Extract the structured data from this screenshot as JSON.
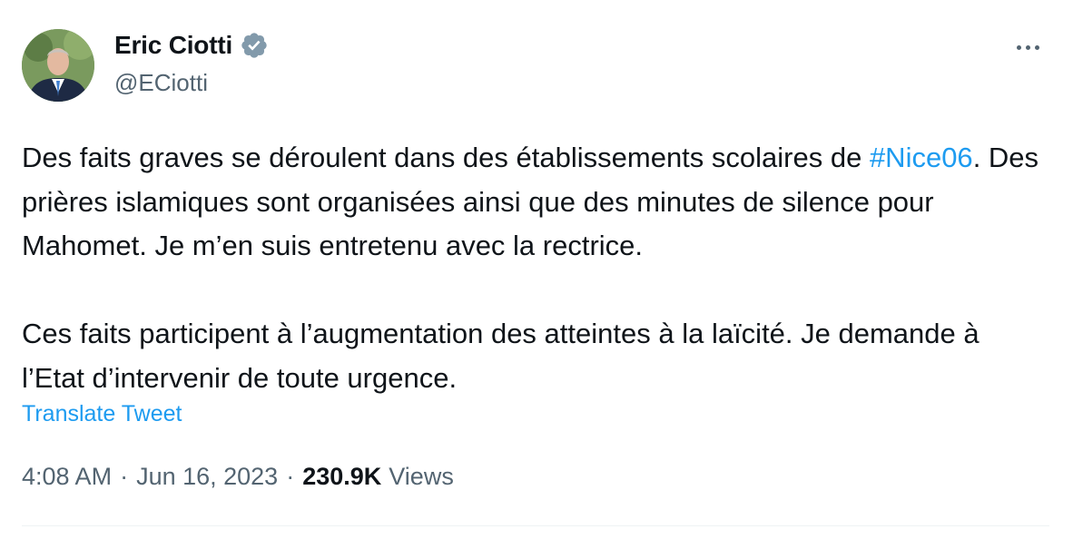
{
  "author": {
    "display_name": "Eric Ciotti",
    "handle": "@ECiotti",
    "verified_badge_color": "#829aab"
  },
  "tweet": {
    "paragraph1_part1": "Des faits graves se déroulent dans des établissements scolaires de ",
    "hashtag": "#Nice06",
    "paragraph1_part2": ". Des prières islamiques sont organisées ainsi que des minutes de silence pour Mahomet. Je m’en suis entretenu avec la rectrice.",
    "paragraph2": "Ces faits participent à l’augmentation des atteintes à la laïcité. Je demande à l’Etat d’intervenir de toute urgence.",
    "translate_label": "Translate Tweet"
  },
  "meta": {
    "time": "4:08 AM",
    "separator": "·",
    "date": "Jun 16, 2023",
    "views_count": "230.9K",
    "views_label": "Views"
  },
  "colors": {
    "link": "#1d9bf0",
    "secondary_text": "#536471",
    "primary_text": "#0f1419"
  }
}
